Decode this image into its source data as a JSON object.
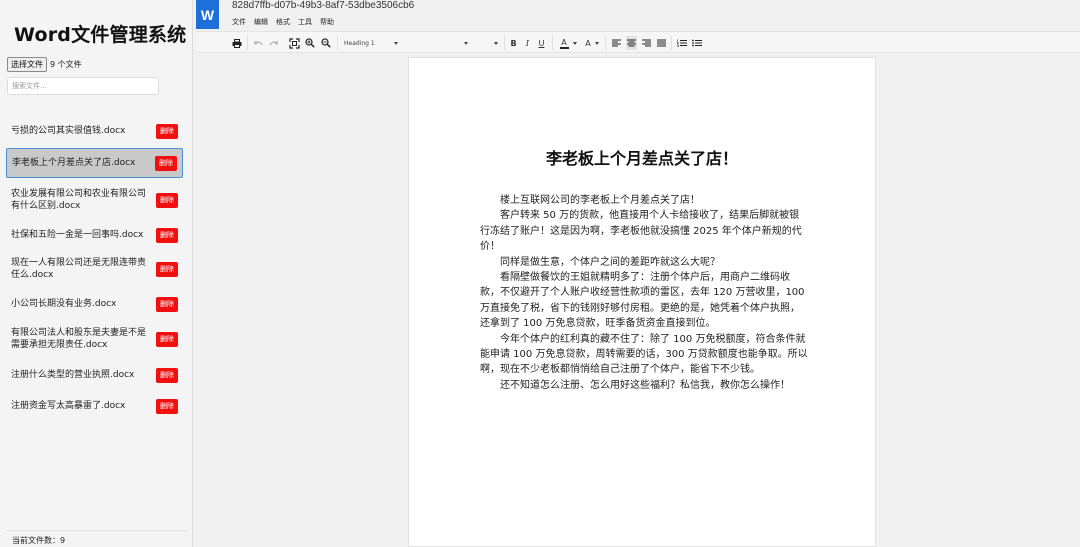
{
  "sidebar": {
    "title": "Word文件管理系统",
    "choose_file_label": "选择文件",
    "selected_count": "9 个文件",
    "search_placeholder": "搜索文件...",
    "delete_label": "删除",
    "files": [
      {
        "name": "亏损的公司其实很值钱.docx"
      },
      {
        "name": "李老板上个月差点关了店.docx"
      },
      {
        "name": "农业发展有限公司和农业有限公司有什么区别.docx"
      },
      {
        "name": "社保和五险一金是一回事吗.docx"
      },
      {
        "name": "现在一人有限公司还是无限连带责任么.docx"
      },
      {
        "name": "小公司长期没有业务.docx"
      },
      {
        "name": "有限公司法人和股东是夫妻是不是需要承担无限责任.docx"
      },
      {
        "name": "注册什么类型的营业执照.docx"
      },
      {
        "name": "注册资金写太高暴雷了.docx"
      }
    ],
    "active_index": 1,
    "footer_count": "当前文件数：9"
  },
  "header": {
    "logo_letter": "W",
    "doc_id": "828d7ffb-d07b-49b3-8af7-53dbe3506cb6",
    "menu": [
      "文件",
      "编辑",
      "格式",
      "工具",
      "帮助"
    ]
  },
  "toolbar": {
    "style_value": "Heading 1",
    "bold": "B",
    "italic": "I",
    "underline": "U",
    "font_color": "A",
    "highlight": "A"
  },
  "document": {
    "title": "李老板上个月差点关了店！",
    "paragraphs": [
      "楼上互联网公司的李老板上个月差点关了店！",
      "客户转来 50 万的货款，他直接用个人卡给接收了，结果后脚就被银行冻结了账户！这是因为啊，李老板他就没搞懂 2025 年个体户新规的代价！",
      "同样是做生意，个体户之间的差距咋就这么大呢？",
      "看隔壁做餐饮的王姐就精明多了：注册个体户后，用商户二维码收款，不仅避开了个人账户收经营性款项的雷区，去年 120 万营收里，100 万直接免了税，省下的钱刚好够付房租。更绝的是，她凭着个体户执照，还拿到了 100 万免息贷款，旺季备货资金直接到位。",
      "今年个体户的红利真的藏不住了：除了 100 万免税额度，符合条件就能申请 100 万免息贷款，周转需要的话，300 万贷款额度也能争取。所以啊，现在不少老板都悄悄给自己注册了个体户，能省下不少钱。",
      "还不知道怎么注册、怎么用好这些福利？私信我，教你怎么操作！"
    ]
  },
  "colors": {
    "accent": "#1e6fd9",
    "delete": "#f01010",
    "active_border": "#4a90d9"
  }
}
